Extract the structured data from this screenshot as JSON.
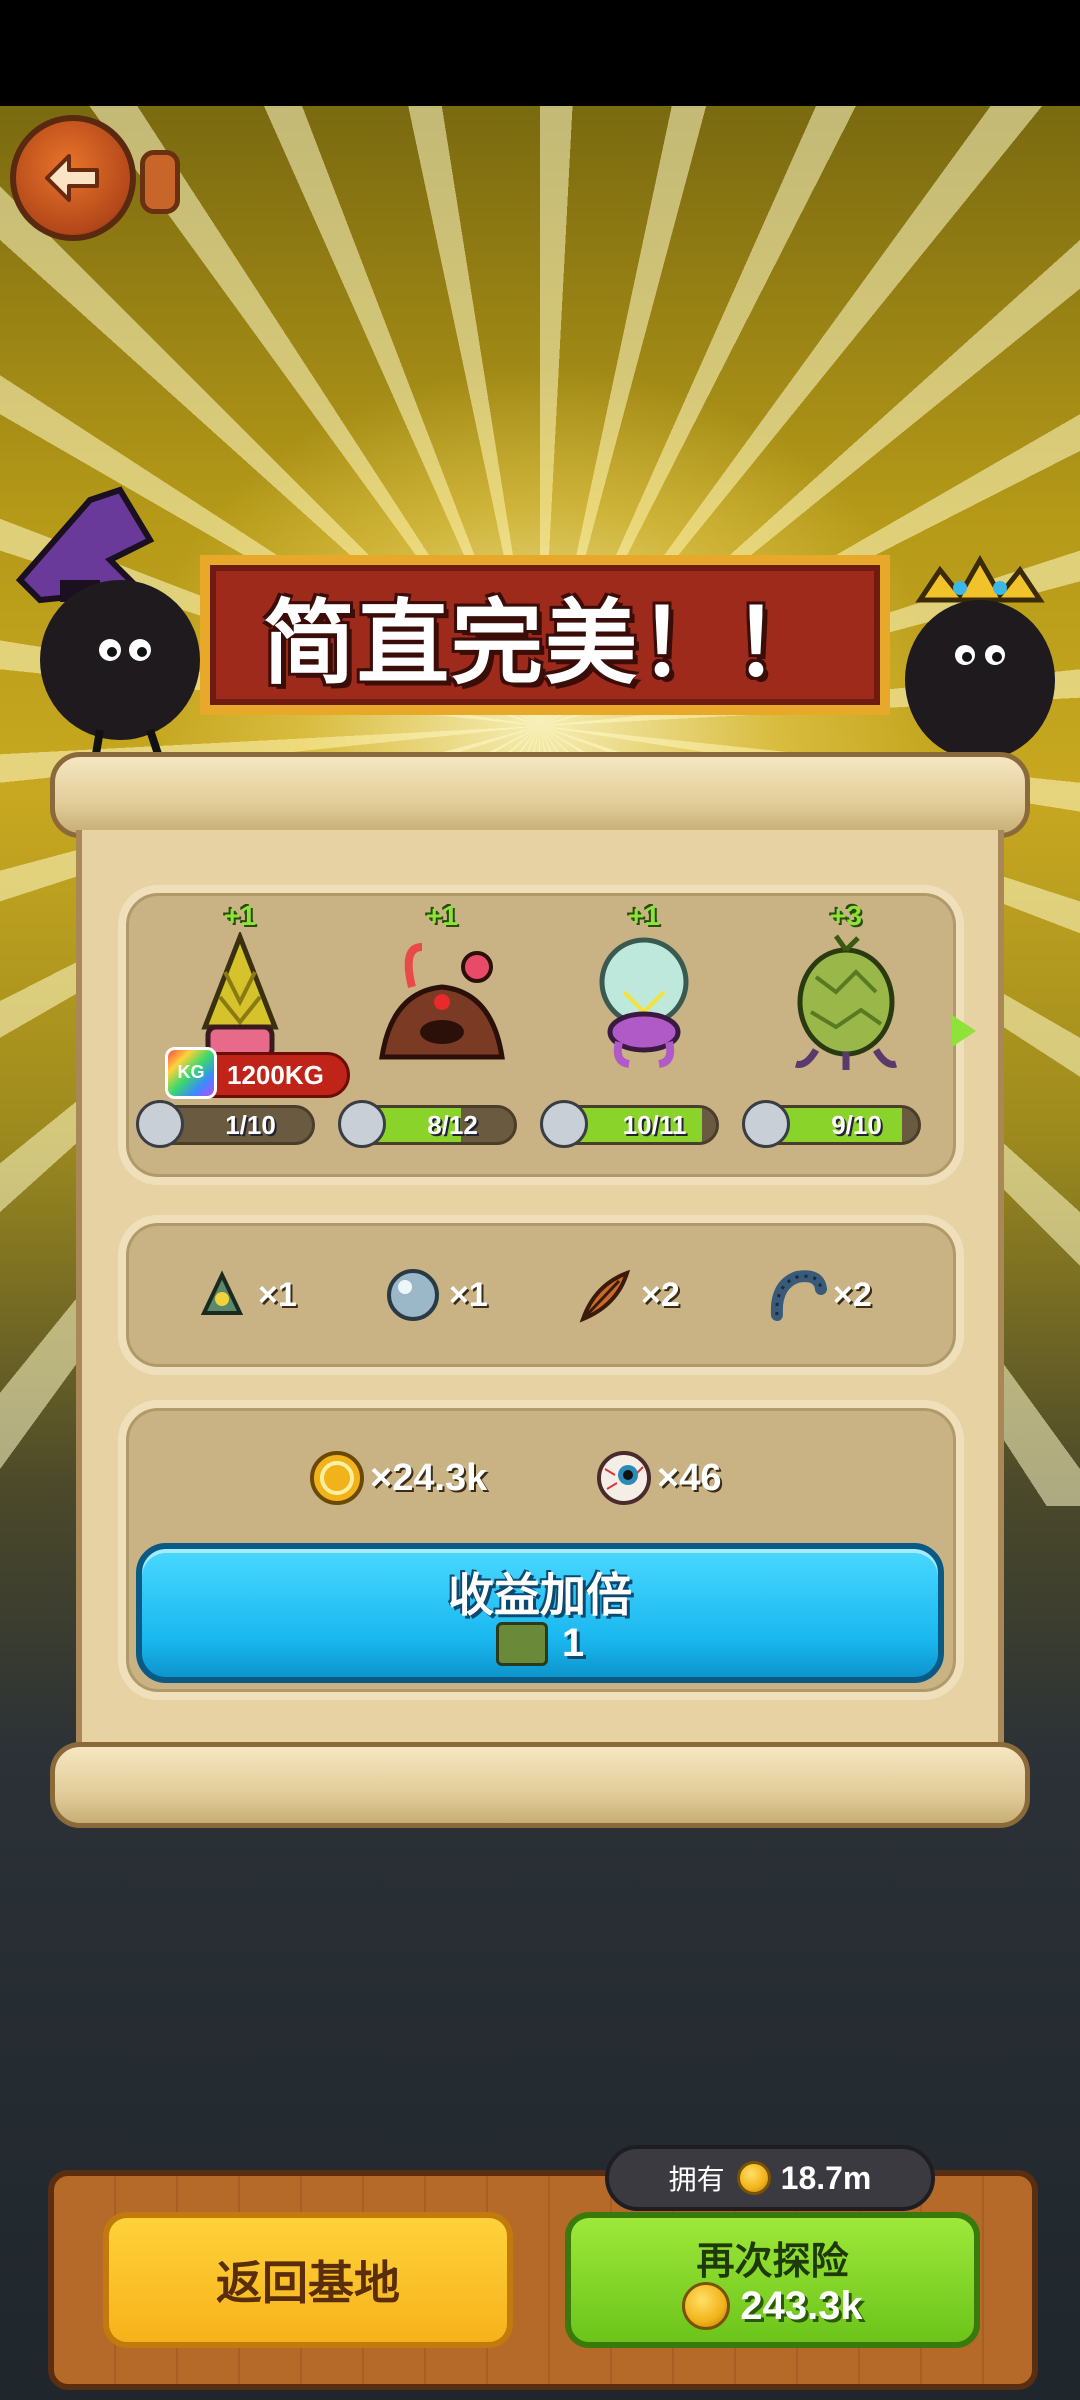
{
  "banner": {
    "title": "简直完美！！"
  },
  "monsters": [
    {
      "plus": "+1",
      "progress": "1/10",
      "fraction": 0.1,
      "weight": "1200KG",
      "weight_icon": "KG"
    },
    {
      "plus": "+1",
      "progress": "8/12",
      "fraction": 0.667
    },
    {
      "plus": "+1",
      "progress": "10/11",
      "fraction": 0.909
    },
    {
      "plus": "+3",
      "progress": "9/10",
      "fraction": 0.9
    }
  ],
  "items": [
    {
      "icon": "gadget-icon",
      "qty": "×1"
    },
    {
      "icon": "pearl-icon",
      "qty": "×1"
    },
    {
      "icon": "feather-icon",
      "qty": "×2"
    },
    {
      "icon": "worm-icon",
      "qty": "×2"
    }
  ],
  "rewards": [
    {
      "icon": "coin-icon",
      "qty": "×24.3k"
    },
    {
      "icon": "eyeball-icon",
      "qty": "×46"
    }
  ],
  "double_reward": {
    "label": "收益加倍",
    "cost": "1",
    "cost_icon": "ticket-icon"
  },
  "footer": {
    "owned_label": "拥有",
    "owned_value": "18.7m",
    "return_label": "返回基地",
    "explore_label": "再次探险",
    "explore_cost": "243.3k"
  },
  "colors": {
    "banner_red": "#9e2a1c",
    "double_button": "#1ab8f0",
    "return_button": "#f7b21a",
    "explore_button": "#7cd42a",
    "progress_fill": "#8ad32a"
  }
}
